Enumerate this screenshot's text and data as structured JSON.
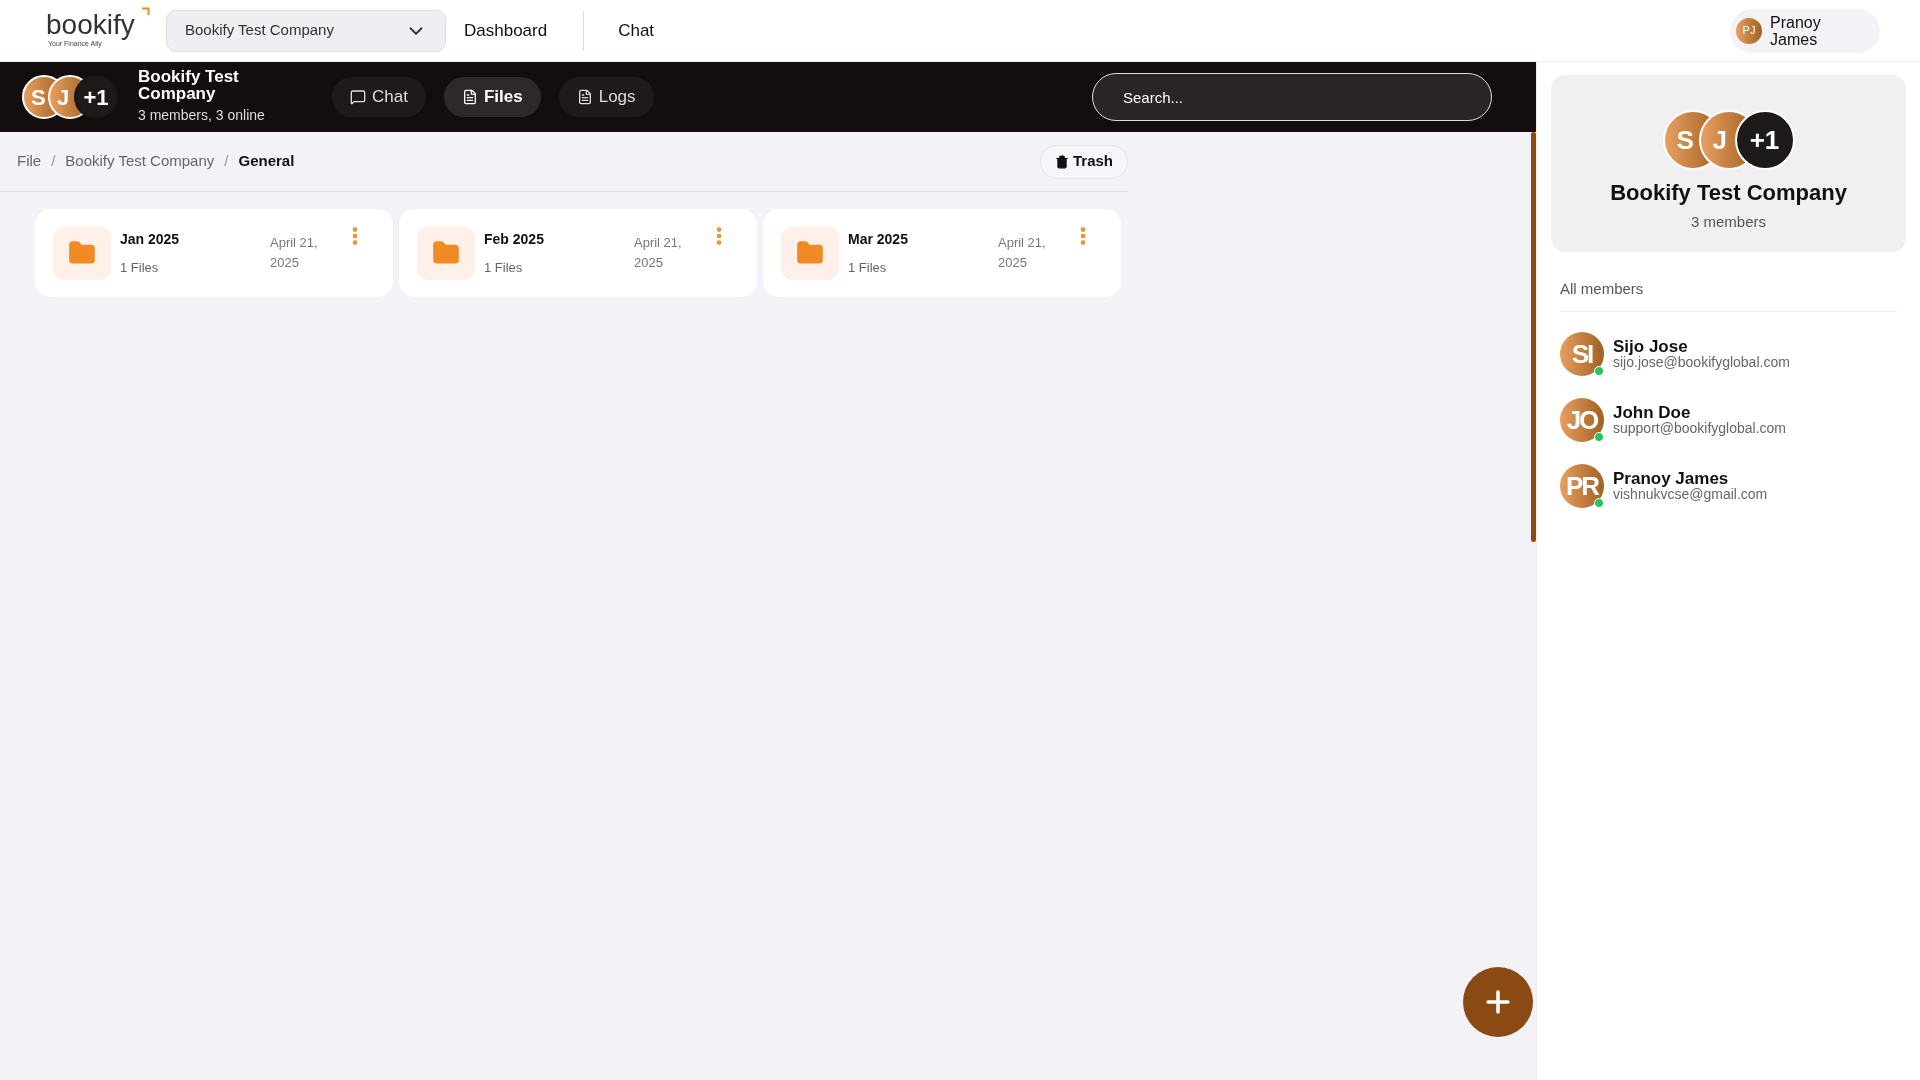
{
  "topbar": {
    "logo": {
      "name": "bookify",
      "tagline": "Your Finance Ally"
    },
    "company_select": {
      "value": "Bookify Test Company"
    },
    "nav": [
      {
        "label": "Dashboard"
      },
      {
        "label": "Chat"
      }
    ],
    "user": {
      "initials": "PJ",
      "name": "Pranoy James"
    }
  },
  "group_header": {
    "avatars": [
      {
        "initials": "S"
      },
      {
        "initials": "J"
      }
    ],
    "more": "+1",
    "title": "Bookify Test Company",
    "subtitle": "3 members, 3 online",
    "tabs": [
      {
        "label": "Chat",
        "selected": false
      },
      {
        "label": "Files",
        "selected": true
      },
      {
        "label": "Logs",
        "selected": false
      }
    ],
    "search": {
      "placeholder": "Search..."
    }
  },
  "breadcrumb": {
    "separator": "/",
    "items": [
      {
        "label": "File",
        "current": false
      },
      {
        "label": "Bookify Test Company",
        "current": false
      },
      {
        "label": "General",
        "current": true
      }
    ]
  },
  "trash_button": "Trash",
  "folders": [
    {
      "name": "Jan 2025",
      "count": "1 Files",
      "date": "April 21, 2025"
    },
    {
      "name": "Feb 2025",
      "count": "1 Files",
      "date": "April 21, 2025"
    },
    {
      "name": "Mar 2025",
      "count": "1 Files",
      "date": "April 21, 2025"
    }
  ],
  "side_panel": {
    "avatars": [
      {
        "initials": "S"
      },
      {
        "initials": "J"
      }
    ],
    "more": "+1",
    "title": "Bookify Test Company",
    "subtitle": "3 members",
    "section": "All members",
    "members": [
      {
        "initials": "SI",
        "name": "Sijo Jose",
        "email": "sijo.jose@bookifyglobal.com",
        "online": true
      },
      {
        "initials": "JO",
        "name": "John Doe",
        "email": "support@bookifyglobal.com",
        "online": true
      },
      {
        "initials": "PR",
        "name": "Pranoy James",
        "email": "vishnukvcse@gmail.com",
        "online": true
      }
    ]
  }
}
